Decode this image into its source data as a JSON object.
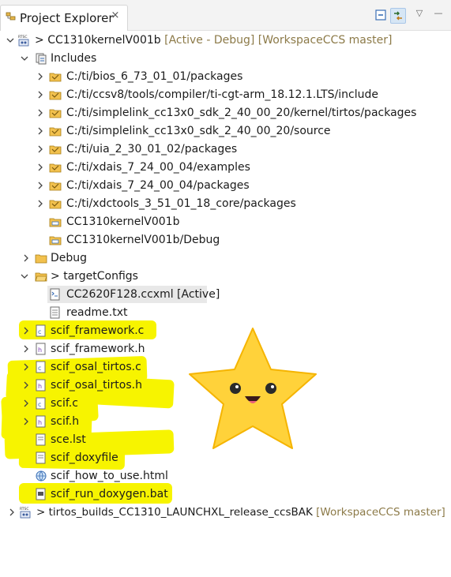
{
  "tab": {
    "title": "Project Explorer",
    "close": "×"
  },
  "toolbar": {
    "collapse_icon": "collapse-all-icon",
    "link_icon": "link-with-editor-icon",
    "view_menu": "▽",
    "minimize": "—"
  },
  "projects": [
    {
      "name": "CC1310kernelV001b",
      "prefix": "> ",
      "decoration": " [Active - Debug] [WorkspaceCCS master]",
      "badge": "RTSC"
    },
    {
      "name": "tirtos_builds_CC1310_LAUNCHXL_release_ccsBAK",
      "prefix": "> ",
      "decoration": " [WorkspaceCCS master]",
      "badge": "RTSC"
    }
  ],
  "tree": {
    "includes_label": "Includes",
    "include_paths": [
      "C:/ti/bios_6_73_01_01/packages",
      "C:/ti/ccsv8/tools/compiler/ti-cgt-arm_18.12.1.LTS/include",
      "C:/ti/simplelink_cc13x0_sdk_2_40_00_20/kernel/tirtos/packages",
      "C:/ti/simplelink_cc13x0_sdk_2_40_00_20/source",
      "C:/ti/uia_2_30_01_02/packages",
      "C:/ti/xdais_7_24_00_04/examples",
      "C:/ti/xdais_7_24_00_04/packages",
      "C:/ti/xdctools_3_51_01_18_core/packages"
    ],
    "project_refs": [
      "CC1310kernelV001b",
      "CC1310kernelV001b/Debug"
    ],
    "debug_folder": "Debug",
    "target_configs": {
      "prefix": "> ",
      "name": "targetConfigs",
      "files": [
        "CC2620F128.ccxml [Active]",
        "readme.txt"
      ]
    },
    "files": [
      "scif_framework.c",
      "scif_framework.h",
      "scif_osal_tirtos.c",
      "scif_osal_tirtos.h",
      "scif.c",
      "scif.h",
      "sce.lst",
      "scif_doxyfile",
      "scif_how_to_use.html",
      "scif_run_doxygen.bat"
    ]
  },
  "colors": {
    "highlight": "#f7f400",
    "decoration": "#8c7a48",
    "folder": "#f2c14e",
    "star": "#ffd23a"
  }
}
